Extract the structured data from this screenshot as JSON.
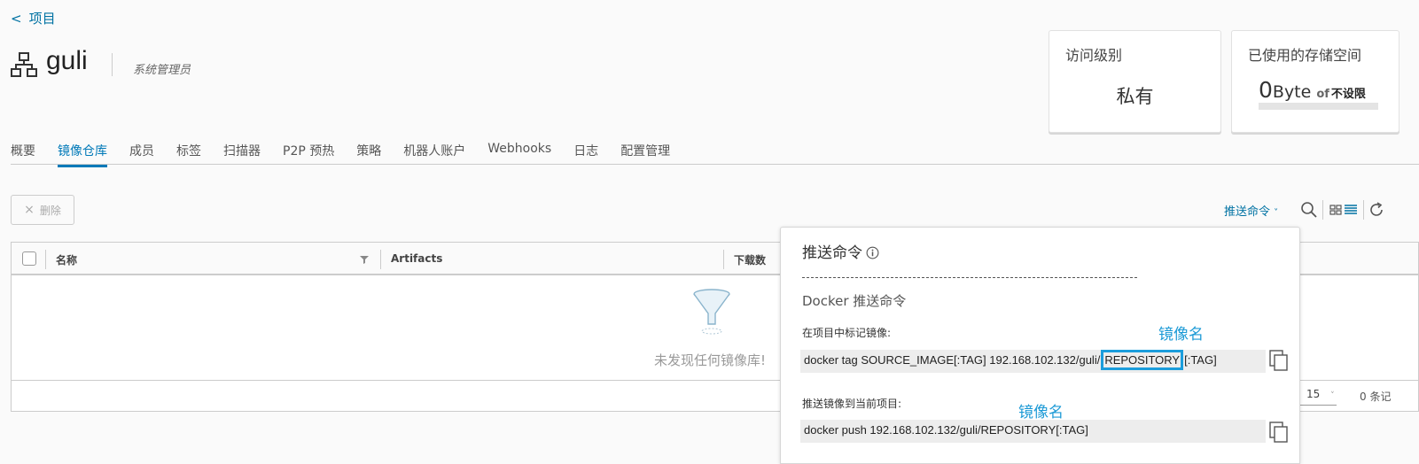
{
  "back": {
    "arrow": "<",
    "label": "项目"
  },
  "project": {
    "name": "guli",
    "role": "系统管理员"
  },
  "cards": {
    "access": {
      "title": "访问级别",
      "value": "私有"
    },
    "storage": {
      "title": "已使用的存储空间",
      "used": "0",
      "unit": "Byte",
      "of": "of",
      "limit": "不设限",
      "usage_fraction": 0
    }
  },
  "tabs": [
    {
      "label": "概要",
      "active": false
    },
    {
      "label": "镜像仓库",
      "active": true
    },
    {
      "label": "成员",
      "active": false
    },
    {
      "label": "标签",
      "active": false
    },
    {
      "label": "扫描器",
      "active": false
    },
    {
      "label": "P2P 预热",
      "active": false
    },
    {
      "label": "策略",
      "active": false
    },
    {
      "label": "机器人账户",
      "active": false
    },
    {
      "label": "Webhooks",
      "active": false
    },
    {
      "label": "日志",
      "active": false
    },
    {
      "label": "配置管理",
      "active": false
    }
  ],
  "toolbar": {
    "delete_icon": "×",
    "delete_label": "删除",
    "push_label": "推送命令",
    "push_caret": "˅"
  },
  "table": {
    "columns": [
      "名称",
      "Artifacts",
      "下载数"
    ],
    "empty_text": "未发现任何镜像库!",
    "page_size": "15",
    "page_size_caret": "˅",
    "total": "0 条记"
  },
  "popover": {
    "title": "推送命令",
    "subtitle": "Docker 推送命令",
    "tag_label": "在项目中标记镜像:",
    "tag_cmd_pre": "docker tag SOURCE_IMAGE[:TAG] 192.168.102.132/guli/",
    "tag_cmd_repo": "REPOSITORY",
    "tag_cmd_post": "[:TAG]",
    "push_label": "推送镜像到当前项目:",
    "push_cmd": "docker push 192.168.102.132/guli/REPOSITORY[:TAG]",
    "annotation1": "镜像名",
    "annotation2": "镜像名"
  },
  "colors": {
    "accent": "#0072a3",
    "annotation": "#1c9ad6",
    "active_tab": "#0079b8"
  },
  "icons": [
    "project-icon",
    "filter-icon",
    "search-icon",
    "grid-view-icon",
    "list-view-icon",
    "refresh-icon",
    "info-icon",
    "copy-icon",
    "empty-funnel-icon"
  ]
}
